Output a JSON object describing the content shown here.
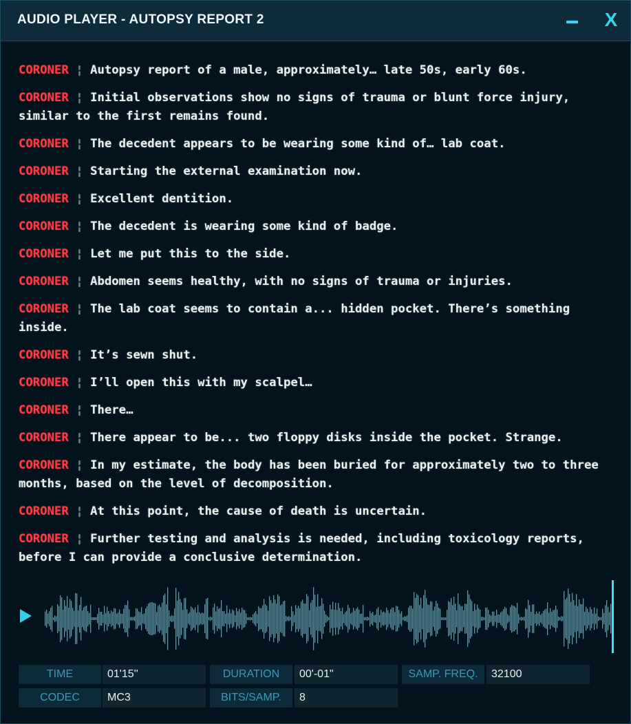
{
  "window": {
    "title": "AUDIO PLAYER - AUTOPSY REPORT 2",
    "close_label": "X",
    "accent_color": "#32d7ee",
    "speaker_color": "#ff3b44"
  },
  "transcript": [
    {
      "speaker": "CORONER",
      "text": "Autopsy report of a male, approximately… late 50s, early 60s."
    },
    {
      "speaker": "CORONER",
      "text": "Initial observations show no signs of trauma or blunt force injury, similar to the first remains found."
    },
    {
      "speaker": "CORONER",
      "text": "The decedent appears to be wearing some kind of… lab coat."
    },
    {
      "speaker": "CORONER",
      "text": "Starting the external examination now."
    },
    {
      "speaker": "CORONER",
      "text": "Excellent dentition."
    },
    {
      "speaker": "CORONER",
      "text": "The decedent is wearing some kind of badge."
    },
    {
      "speaker": "CORONER",
      "text": "Let me put this to the side."
    },
    {
      "speaker": "CORONER",
      "text": "Abdomen seems healthy, with no signs of trauma or injuries."
    },
    {
      "speaker": "CORONER",
      "text": "The lab coat seems to contain a... hidden pocket. There’s something inside."
    },
    {
      "speaker": "CORONER",
      "text": "It’s sewn shut."
    },
    {
      "speaker": "CORONER",
      "text": "I’ll open this with my scalpel…"
    },
    {
      "speaker": "CORONER",
      "text": "There…"
    },
    {
      "speaker": "CORONER",
      "text": "There appear to be... two floppy disks inside the pocket. Strange."
    },
    {
      "speaker": "CORONER",
      "text": "In my estimate, the body has been buried for approximately two to three months, based on the level of decomposition."
    },
    {
      "speaker": "CORONER",
      "text": "At this point, the cause of death is uncertain."
    },
    {
      "speaker": "CORONER",
      "text": "Further testing and analysis is needed, including toxicology reports, before I can provide a conclusive determination."
    }
  ],
  "player": {
    "progress": 1.0,
    "waveform_color": "#3fa2bd",
    "playhead_color": "#3ee0f5"
  },
  "info": {
    "time_label": "TIME",
    "time_value": "01'15''",
    "duration_label": "DURATION",
    "duration_value": "00'-01\"",
    "freq_label": "SAMP. FREQ.",
    "freq_value": "32100",
    "codec_label": "CODEC",
    "codec_value": "MC3",
    "bits_label": "BITS/SAMP.",
    "bits_value": "8"
  }
}
